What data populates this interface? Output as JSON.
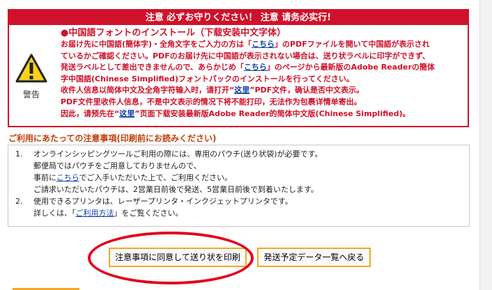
{
  "warning": {
    "header": "注意 必ずお守りください！ 注意 请务必实行!",
    "icon": "warning-triangle-icon",
    "icon_label": "警告",
    "subtitle": "●中国語フォントのインストール（下载安装中文字体）",
    "line1_pre": "お届け先に中国語(簡体字)・全角文字をご入力の方は「",
    "line1_link": "こちら",
    "line1_post": "」のPDFファイルを開いて中国語が表示され",
    "line2": "ているかご確認ください。PDFのお届け先に中国語が表示されない場合は、送り状ラベルに印字ができず、",
    "line3_pre": "発送ラベルとして差出できませんので、あらかじめ「",
    "line3_link": "こちら",
    "line3_post": "」のページから最新版のAdobe Readerの簡体",
    "line4": "字中国語(Chinese Simplified)フォントパックのインストールを行ってください。",
    "line5_pre": "收件人信息以简体中文及全角字符输入时，请打开“",
    "line5_link": "这里",
    "line5_post": "”PDF文件，确认是否中文表示。",
    "line6": "PDF文件里收件人信息，不是中文表示的情况下将不能打印，无法作为包裹详情单寄出。",
    "line7_pre": "因此，请预先在“",
    "line7_link": "这里",
    "line7_post": "”页面下载安装最新版Adobe Reader的简体中文版(Chinese Simplified)。"
  },
  "notes": {
    "title": "ご利用にあたっての注意事項(印刷前にお読みください)",
    "items": [
      {
        "num": "1.",
        "text": "オンラインシッピングツールご利用の際には、専用のパウチ(送り状袋)が必要です。"
      },
      {
        "num": "",
        "text": "郵便局ではパウチをご用意しておりませんので、"
      },
      {
        "num": "",
        "text_pre": "事前に",
        "link": "こちら",
        "text_post": "でご入手いただいた上で、ご利用ください。"
      },
      {
        "num": "",
        "text": "ご請求いただいたパウチは、2営業日前後で発送、5営業日前後で到着いたします。"
      },
      {
        "num": "2.",
        "text": "使用できるプリンタは、レーザープリンタ・インクジェットプリンタです。"
      },
      {
        "num": "",
        "text_pre": "詳しくは、「",
        "link": "ご利用方法",
        "text_post": "」をご覧ください。"
      }
    ]
  },
  "buttons": {
    "print": "注意事項に同意して送り状を印刷",
    "back": "発送予定データ一覧へ戻る"
  },
  "colors": {
    "warning_red": "#d0112b",
    "button_border": "#f5a623",
    "highlight": "#e3001b",
    "link_blue": "#0b3ea8"
  }
}
